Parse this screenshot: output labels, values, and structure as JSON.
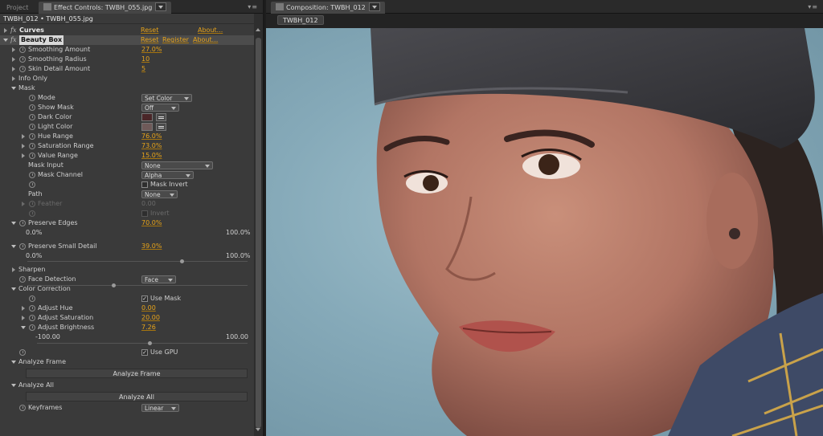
{
  "project_tab": "Project",
  "effect_controls_tab": "Effect Controls: TWBH_055.jpg",
  "composition_tab": "Composition: TWBH_012",
  "comp_chip": "TWBH_012",
  "layer_path": "TWBH_012 • TWBH_055.jpg",
  "effects": {
    "curves": {
      "name": "Curves",
      "reset": "Reset",
      "about": "About..."
    },
    "beauty_box": {
      "name": "Beauty Box",
      "reset": "Reset",
      "register": "Register",
      "about": "About..."
    }
  },
  "params": {
    "smoothing_amount": {
      "label": "Smoothing Amount",
      "value": "27.0%"
    },
    "smoothing_radius": {
      "label": "Smoothing Radius",
      "value": "10"
    },
    "skin_detail_amount": {
      "label": "Skin Detail Amount",
      "value": "5"
    },
    "info_only": "Info Only",
    "mask": "Mask",
    "mode": {
      "label": "Mode",
      "value": "Set Color"
    },
    "show_mask": {
      "label": "Show Mask",
      "value": "Off"
    },
    "dark_color": {
      "label": "Dark Color",
      "color": "#4a2628"
    },
    "light_color": {
      "label": "Light Color",
      "color": "#6f5a59"
    },
    "hue_range": {
      "label": "Hue Range",
      "value": "76.0%"
    },
    "saturation_range": {
      "label": "Saturation Range",
      "value": "73.0%"
    },
    "value_range": {
      "label": "Value Range",
      "value": "15.0%"
    },
    "mask_input": {
      "label": "Mask Input",
      "value": "None"
    },
    "mask_channel": {
      "label": "Mask Channel",
      "value": "Alpha"
    },
    "mask_invert": "Mask Invert",
    "path": {
      "label": "Path",
      "value": "None"
    },
    "feather": {
      "label": "Feather",
      "value": "0.00"
    },
    "invert": "Invert",
    "preserve_edges": {
      "label": "Preserve Edges",
      "value": "70.0%",
      "min": "0.0%",
      "max": "100.0%",
      "level": 0.7
    },
    "preserve_small_detail": {
      "label": "Preserve Small Detail",
      "value": "39.0%",
      "min": "0.0%",
      "max": "100.0%",
      "level": 0.39
    },
    "sharpen": "Sharpen",
    "face_detection": {
      "label": "Face Detection",
      "value": "Face"
    },
    "color_correction": "Color Correction",
    "use_mask": "Use Mask",
    "adjust_hue": {
      "label": "Adjust Hue",
      "value": "0.00"
    },
    "adjust_saturation": {
      "label": "Adjust Saturation",
      "value": "20.00"
    },
    "adjust_brightness": {
      "label": "Adjust Brightness",
      "value": "7.26",
      "min": "-100.00",
      "max": "100.00",
      "level": 0.536
    },
    "use_gpu": "Use GPU",
    "analyze_frame": {
      "label": "Analyze Frame",
      "button": "Analyze Frame"
    },
    "analyze_all": {
      "label": "Analyze All",
      "button": "Analyze All"
    },
    "keyframes": {
      "label": "Keyframes",
      "value": "Linear"
    }
  },
  "menu_glyph": "▾≡",
  "checkmark": "✓"
}
